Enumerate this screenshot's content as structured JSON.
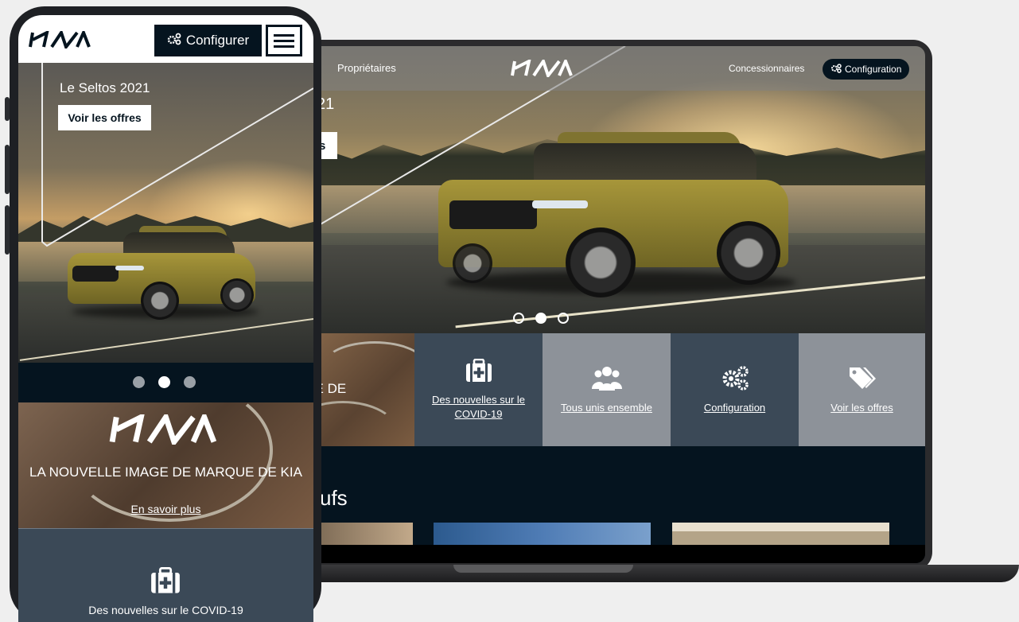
{
  "laptop": {
    "nav": {
      "left_link": "Propriétaires",
      "dealers_link": "Concessionnaires",
      "config_button": "Configuration"
    },
    "hero": {
      "title_fragment": "21",
      "button_fragment": "s",
      "slide_count": 3,
      "active_slide": 2
    },
    "tiles": {
      "brand_fragment": "AGE DE\nKIA",
      "covid": "Des nouvelles sur le COVID-19",
      "unis": "Tous unis ensemble",
      "config": "Configuration",
      "offres": "Voir les offres"
    },
    "lower": {
      "heading_fragment": "ufs"
    }
  },
  "phone": {
    "header": {
      "config_button": "Configurer"
    },
    "hero": {
      "title": "Le Seltos 2021",
      "button": "Voir les offres",
      "slide_count": 3,
      "active_slide": 2
    },
    "brand": {
      "title": "LA NOUVELLE IMAGE DE MARQUE DE KIA",
      "link": "En savoir plus"
    },
    "covid": {
      "label": "Des nouvelles sur le COVID-19"
    }
  },
  "colors": {
    "kia_navy": "#05141f",
    "tile_slate": "#3b4957",
    "tile_gray": "#8d9299",
    "background": "#efefef"
  },
  "icons": {
    "config": "gears-icon",
    "covid": "first-aid-kit-icon",
    "unis": "people-group-icon",
    "offres": "tags-icon",
    "menu": "hamburger-menu-icon"
  }
}
